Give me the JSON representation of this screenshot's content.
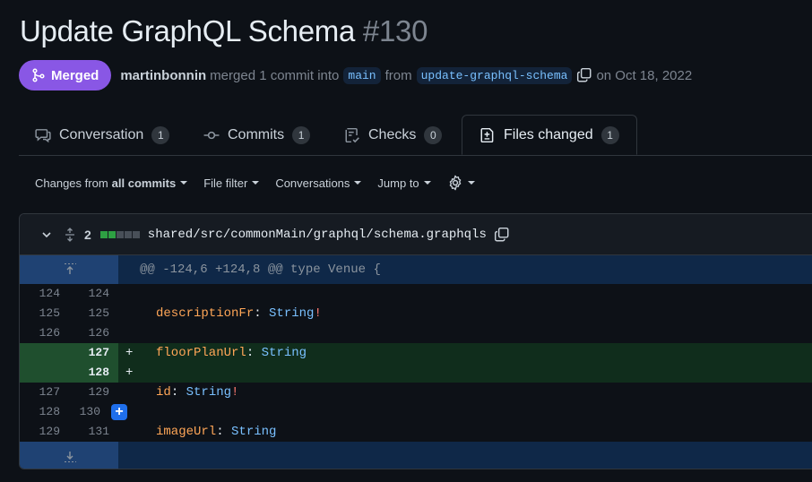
{
  "pr": {
    "title": "Update GraphQL Schema",
    "number": "#130",
    "status": "Merged",
    "author": "martinbonnin",
    "merge_text": "merged 1 commit into",
    "base_branch": "main",
    "from_text": "from",
    "head_branch": "update-graphql-schema",
    "date_text": "on Oct 18, 2022"
  },
  "tabs": [
    {
      "label": "Conversation",
      "count": "1"
    },
    {
      "label": "Commits",
      "count": "1"
    },
    {
      "label": "Checks",
      "count": "0"
    },
    {
      "label": "Files changed",
      "count": "1"
    }
  ],
  "toolbar": {
    "changes_prefix": "Changes from",
    "changes_value": "all commits",
    "file_filter": "File filter",
    "conversations": "Conversations",
    "jump_to": "Jump to"
  },
  "file": {
    "changed_lines": "2",
    "path": "shared/src/commonMain/graphql/schema.graphqls",
    "hunk_header": "@@ -124,6 +124,8 @@ type Venue {",
    "lines": [
      {
        "old": "124",
        "new": "124",
        "marker": "",
        "prop": "",
        "sep": "",
        "type": "",
        "bang": ""
      },
      {
        "old": "125",
        "new": "125",
        "marker": "",
        "prop": "descriptionFr",
        "sep": ": ",
        "type": "String",
        "bang": "!"
      },
      {
        "old": "126",
        "new": "126",
        "marker": "",
        "prop": "",
        "sep": "",
        "type": "",
        "bang": ""
      },
      {
        "old": "",
        "new": "127",
        "marker": "+",
        "prop": "floorPlanUrl",
        "sep": ": ",
        "type": "String",
        "bang": ""
      },
      {
        "old": "",
        "new": "128",
        "marker": "+",
        "prop": "",
        "sep": "",
        "type": "",
        "bang": ""
      },
      {
        "old": "127",
        "new": "129",
        "marker": "",
        "prop": "id",
        "sep": ": ",
        "type": "String",
        "bang": "!"
      },
      {
        "old": "128",
        "new": "130",
        "marker": "",
        "prop": "",
        "sep": "",
        "type": "",
        "bang": ""
      },
      {
        "old": "129",
        "new": "131",
        "marker": "",
        "prop": "imageUrl",
        "sep": ": ",
        "type": "String",
        "bang": ""
      }
    ],
    "add_comment_symbol": "+"
  },
  "colors": {
    "merged": "#8957e5",
    "addition": "#102d1c",
    "hunk": "#0f2848",
    "accent_blue": "#1f6feb"
  }
}
